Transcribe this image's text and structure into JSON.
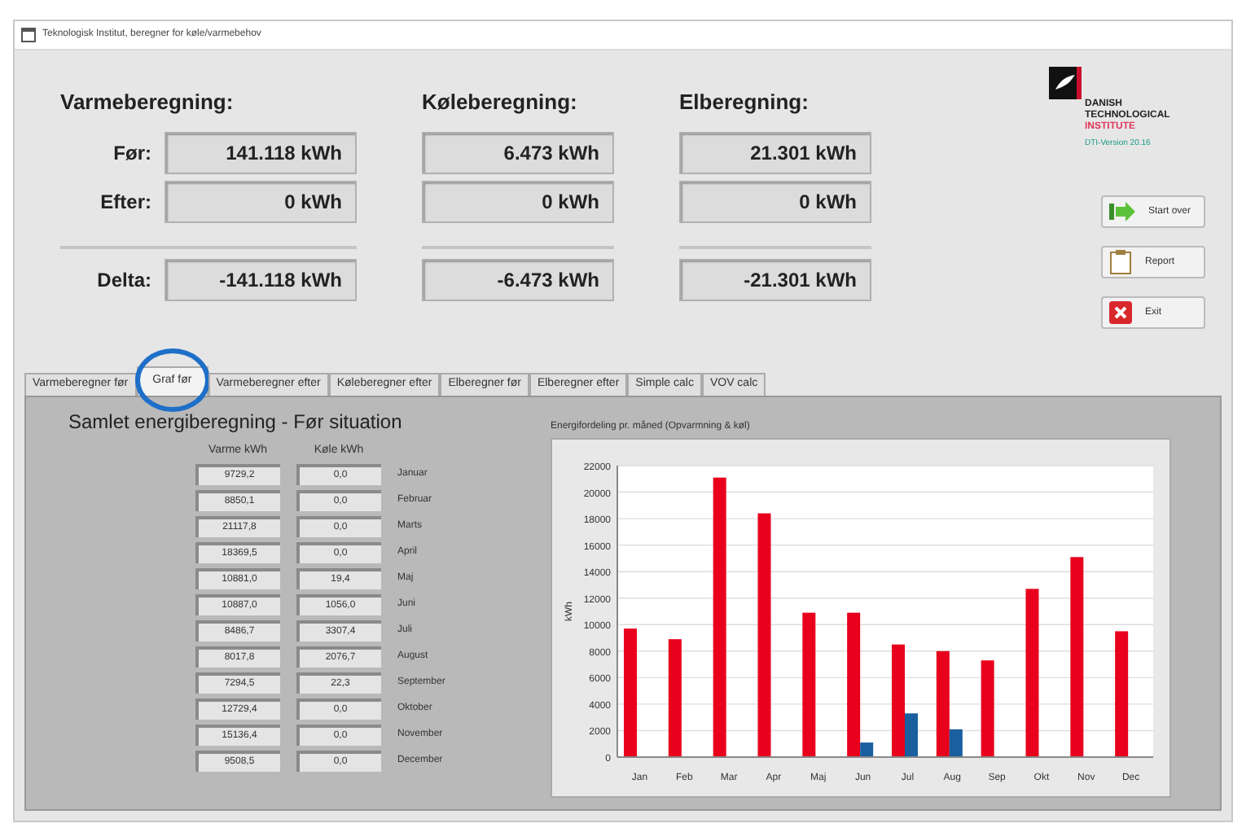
{
  "window": {
    "title": "Teknologisk Institut, beregner for køle/varmebehov"
  },
  "summary": [
    {
      "heading": "Varmeberegning:",
      "rows": [
        {
          "label": "Før:",
          "value": "141.118 kWh"
        },
        {
          "label": "Efter:",
          "value": "0 kWh"
        },
        {
          "label": "Delta:",
          "value": "-141.118 kWh"
        }
      ]
    },
    {
      "heading": "Køleberegning:",
      "rows": [
        {
          "value": "6.473 kWh"
        },
        {
          "value": "0 kWh"
        },
        {
          "value": "-6.473 kWh"
        }
      ]
    },
    {
      "heading": "Elberegning:",
      "rows": [
        {
          "value": "21.301 kWh"
        },
        {
          "value": "0 kWh"
        },
        {
          "value": "-21.301 kWh"
        }
      ]
    }
  ],
  "logo": {
    "lines": [
      "DANISH",
      "TECHNOLOGICAL",
      "INSTITUTE"
    ],
    "version": "DTI-Version 20.16"
  },
  "buttons": [
    {
      "label": "Start over",
      "kind": "start"
    },
    {
      "label": "Report",
      "kind": "report"
    },
    {
      "label": "Exit",
      "kind": "exit"
    }
  ],
  "tabs": [
    {
      "label": "Varmeberegner før",
      "selected": false
    },
    {
      "label": "Graf før",
      "selected": true
    },
    {
      "label": "Varmeberegner efter",
      "selected": false
    },
    {
      "label": "Køleberegner efter",
      "selected": false
    },
    {
      "label": "Elberegner før",
      "selected": false
    },
    {
      "label": "Elberegner efter",
      "selected": false
    },
    {
      "label": "Simple calc",
      "selected": false
    },
    {
      "label": "VOV calc",
      "selected": false
    }
  ],
  "panel": {
    "title": "Samlet energiberegning - Før situation",
    "columns": [
      "Varme kWh",
      "Køle kWh"
    ],
    "rows": [
      {
        "varme": "9729,2",
        "kole": "0,0",
        "month": "Januar"
      },
      {
        "varme": "8850,1",
        "kole": "0,0",
        "month": "Februar"
      },
      {
        "varme": "21117,8",
        "kole": "0,0",
        "month": "Marts"
      },
      {
        "varme": "18369,5",
        "kole": "0,0",
        "month": "April"
      },
      {
        "varme": "10881,0",
        "kole": "19,4",
        "month": "Maj"
      },
      {
        "varme": "10887,0",
        "kole": "1056,0",
        "month": "Juni"
      },
      {
        "varme": "8486,7",
        "kole": "3307,4",
        "month": "Juli"
      },
      {
        "varme": "8017,8",
        "kole": "2076,7",
        "month": "August"
      },
      {
        "varme": "7294,5",
        "kole": "22,3",
        "month": "September"
      },
      {
        "varme": "12729,4",
        "kole": "0,0",
        "month": "Oktober"
      },
      {
        "varme": "15136,4",
        "kole": "0,0",
        "month": "November"
      },
      {
        "varme": "9508,5",
        "kole": "0,0",
        "month": "December"
      }
    ],
    "chart_data": {
      "type": "bar",
      "title": "Energifordeling pr. måned (Opvarmning & køl)",
      "ylabel": "kWh",
      "categories": [
        "Jan",
        "Feb",
        "Mar",
        "Apr",
        "Maj",
        "Jun",
        "Jul",
        "Aug",
        "Sep",
        "Okt",
        "Nov",
        "Dec"
      ],
      "series": [
        {
          "color": "#e8001c",
          "values": [
            9700,
            8900,
            21100,
            18400,
            10900,
            10900,
            8500,
            8000,
            7300,
            12700,
            15100,
            9500
          ]
        },
        {
          "color": "#1a5fa0",
          "values": [
            0,
            0,
            0,
            0,
            0,
            1100,
            3300,
            2100,
            0,
            0,
            0,
            0
          ]
        }
      ],
      "grid": true,
      "ylim": [
        0,
        22000
      ],
      "yticks": [
        0,
        2000,
        4000,
        6000,
        8000,
        10000,
        12000,
        14000,
        16000,
        18000,
        20000,
        22000
      ]
    }
  }
}
